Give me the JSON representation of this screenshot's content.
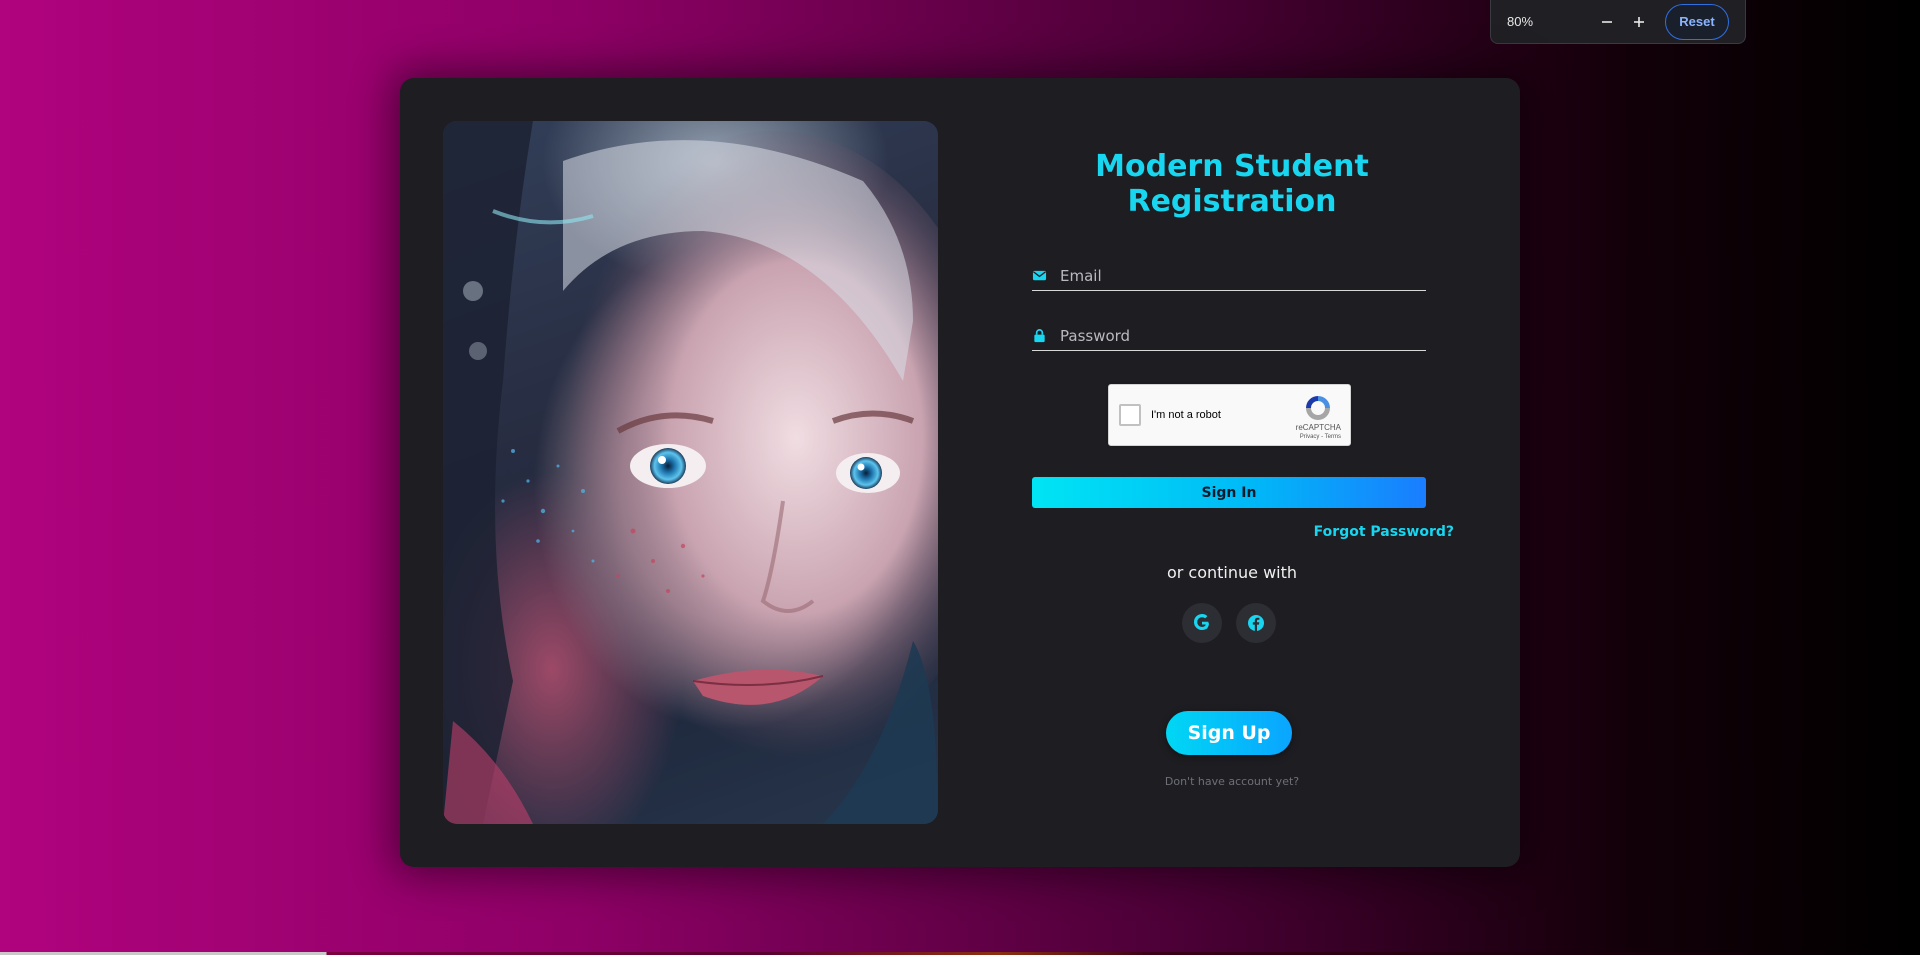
{
  "zoom": {
    "level": "80%",
    "zoom_out_icon": "minus-icon",
    "zoom_in_icon": "plus-icon",
    "reset_label": "Reset"
  },
  "card": {
    "title": "Modern Student Registration",
    "email": {
      "icon": "envelope-icon",
      "placeholder": "Email",
      "value": ""
    },
    "password": {
      "icon": "lock-icon",
      "placeholder": "Password",
      "value": ""
    },
    "captcha": {
      "label": "I'm not a robot",
      "brand": "reCAPTCHA",
      "terms": "Privacy - Terms",
      "checked": false
    },
    "sign_in_label": "Sign In",
    "forgot_label": "Forgot Password?",
    "or_continue": "or continue with",
    "social": [
      {
        "name": "google",
        "icon": "google-icon"
      },
      {
        "name": "facebook",
        "icon": "facebook-icon"
      }
    ],
    "sign_up_label": "Sign Up",
    "no_account": "Don't have account yet?"
  },
  "colors": {
    "accent": "#18d6f0",
    "card_bg": "#1d1d22",
    "bg_left": "#b0037e",
    "bg_right": "#000000"
  }
}
